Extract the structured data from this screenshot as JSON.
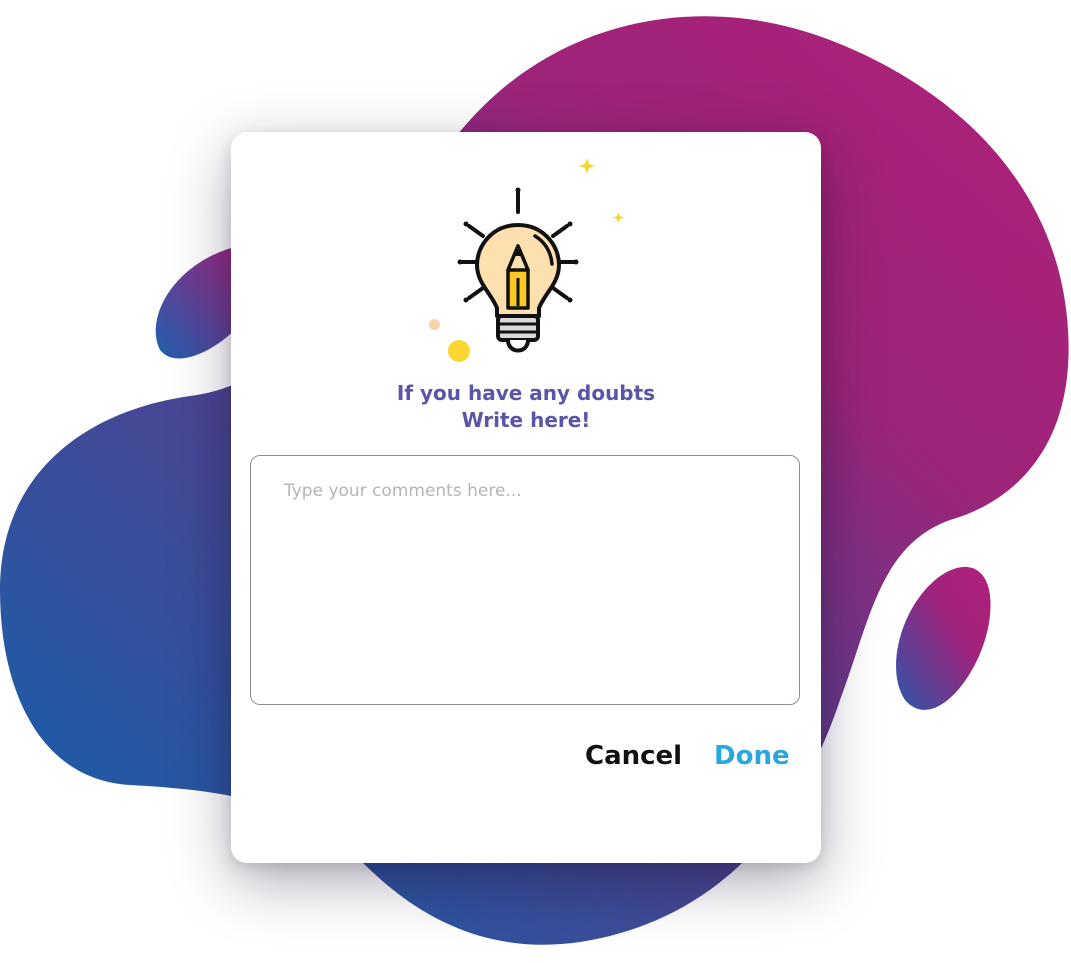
{
  "dialog": {
    "heading_line1": "If you have any doubts",
    "heading_line2": "Write here!",
    "comment_placeholder": "Type your comments here...",
    "comment_value": "",
    "cancel_label": "Cancel",
    "done_label": "Done"
  },
  "icons": {
    "illustration": "lightbulb-pencil-icon",
    "sparkles": "sparkle-icon"
  },
  "colors": {
    "heading": "#5b55a7",
    "done": "#2aa6e0",
    "cancel": "#111111",
    "blob_magenta": "#b0207a",
    "blob_blue": "#0d63ad",
    "bulb_fill": "#fde0b0",
    "pencil": "#f9c823",
    "accent_dot": "#fcd734"
  }
}
